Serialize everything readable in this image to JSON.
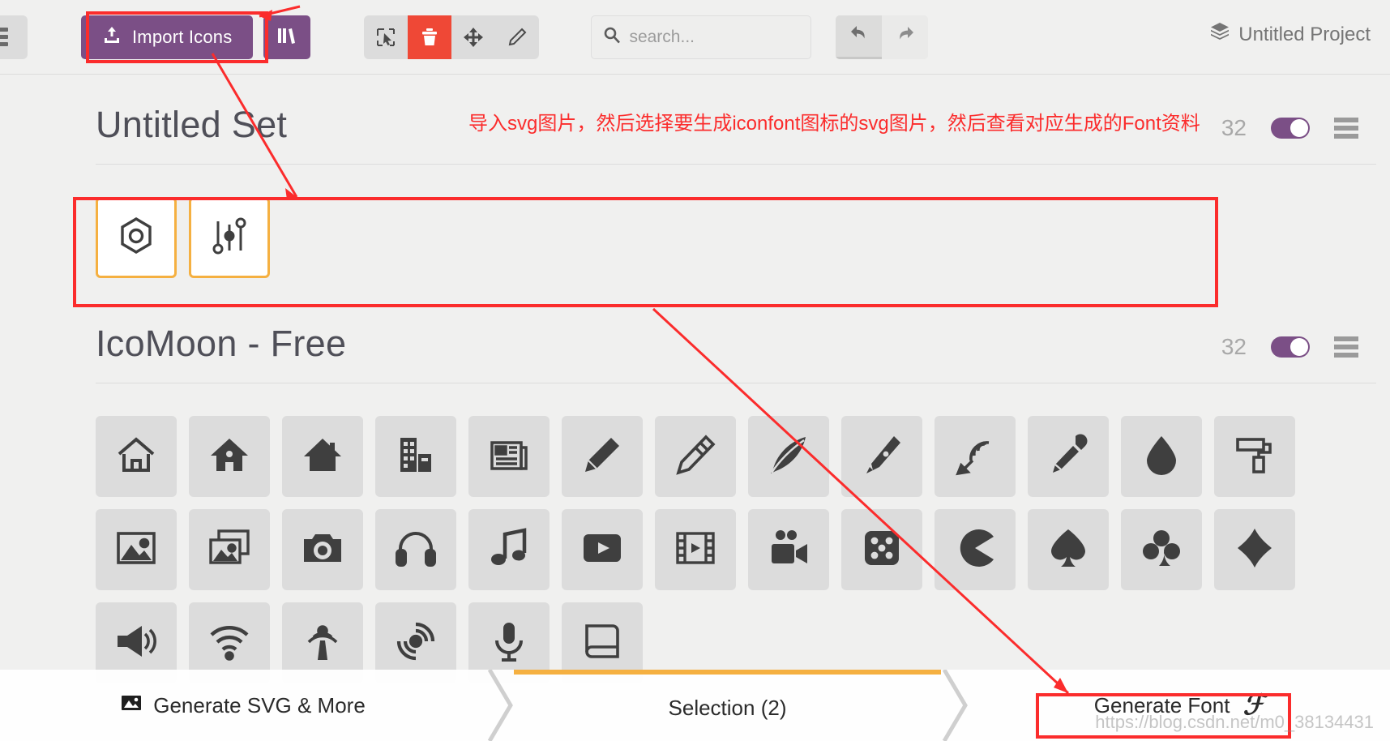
{
  "toolbar": {
    "menu_icon": "hamburger-menu-icon",
    "import_label": "Import Icons",
    "import_icon": "upload-icon",
    "library_icon": "library-books-icon",
    "tools": [
      {
        "name": "select-tool",
        "icon": "cursor-select-icon",
        "active": false
      },
      {
        "name": "delete-tool",
        "icon": "trash-icon",
        "active": true
      },
      {
        "name": "move-tool",
        "icon": "move-arrows-icon",
        "active": false
      },
      {
        "name": "edit-tool",
        "icon": "pencil-icon",
        "active": false
      }
    ],
    "search_placeholder": "search...",
    "search_value": "",
    "search_icon": "search-icon",
    "undo_icon": "undo-arrow-icon",
    "redo_icon": "redo-arrow-icon",
    "project_icon": "layers-stack-icon",
    "project_label": "Untitled Project"
  },
  "sets": [
    {
      "title": "Untitled Set",
      "count": "32",
      "toggle_on": true,
      "menu_icon": "set-menu-icon",
      "icons": [
        {
          "name": "hexagon-nut-icon"
        },
        {
          "name": "equalizer-sliders-icon"
        }
      ]
    },
    {
      "title": "IcoMoon - Free",
      "count": "32",
      "toggle_on": true,
      "menu_icon": "set-menu-icon",
      "icons": [
        {
          "name": "home-outline-icon"
        },
        {
          "name": "home-solid-icon"
        },
        {
          "name": "home-filled-icon"
        },
        {
          "name": "office-building-icon"
        },
        {
          "name": "newspaper-icon"
        },
        {
          "name": "pencil-icon"
        },
        {
          "name": "pencil2-icon"
        },
        {
          "name": "quill-icon"
        },
        {
          "name": "pen-icon"
        },
        {
          "name": "blog-icon"
        },
        {
          "name": "eyedropper-icon"
        },
        {
          "name": "droplet-icon"
        },
        {
          "name": "paint-roller-icon"
        },
        {
          "name": "image-icon"
        },
        {
          "name": "images-icon"
        },
        {
          "name": "camera-icon"
        },
        {
          "name": "headphones-icon"
        },
        {
          "name": "music-note-icon"
        },
        {
          "name": "play-video-icon"
        },
        {
          "name": "film-icon"
        },
        {
          "name": "video-camera-icon"
        },
        {
          "name": "dice-icon"
        },
        {
          "name": "pacman-icon"
        },
        {
          "name": "spades-icon"
        },
        {
          "name": "clubs-icon"
        },
        {
          "name": "diamonds-icon"
        },
        {
          "name": "bullhorn-icon"
        },
        {
          "name": "connection-wifi-icon"
        },
        {
          "name": "podcast-icon"
        },
        {
          "name": "feed-icon"
        },
        {
          "name": "mic-icon"
        },
        {
          "name": "book-icon"
        }
      ]
    }
  ],
  "bottom_bar": {
    "left_label": "Generate SVG & More",
    "left_icon": "image-generate-icon",
    "middle_label": "Selection (2)",
    "right_label": "Generate Font",
    "right_icon": "font-f-glyph-icon"
  },
  "annotation": {
    "note": "导入svg图片，然后选择要生成iconfont图标的svg图片，然后查看对应生成的Font资料",
    "color": "#fb2c2c"
  },
  "watermark": "https://blog.csdn.net/m0_38134431"
}
